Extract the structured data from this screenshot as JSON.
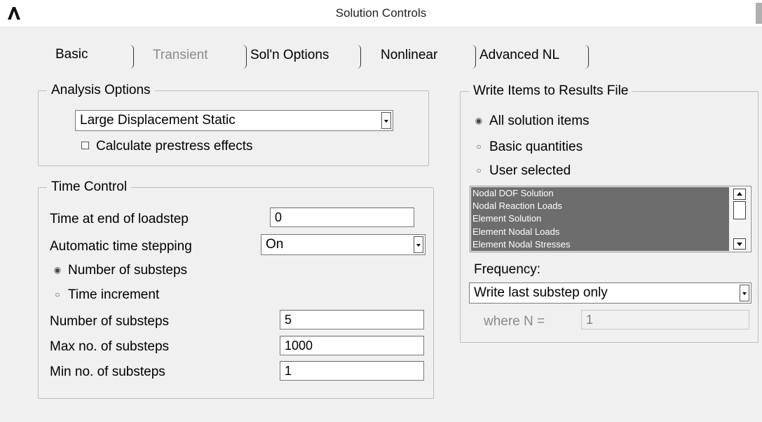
{
  "window": {
    "title": "Solution Controls",
    "icon": "ansys-logo-icon"
  },
  "tabs": [
    {
      "label": "Basic",
      "state": "active"
    },
    {
      "label": "Transient",
      "state": "disabled"
    },
    {
      "label": "Sol'n Options",
      "state": "normal"
    },
    {
      "label": "Nonlinear",
      "state": "normal"
    },
    {
      "label": "Advanced NL",
      "state": "normal"
    }
  ],
  "analysis_options": {
    "title": "Analysis Options",
    "analysis_type": "Large Displacement Static",
    "prestress_label": "Calculate prestress effects",
    "prestress_checked": false
  },
  "time_control": {
    "title": "Time Control",
    "time_end_label": "Time at end of loadstep",
    "time_end_value": "0",
    "auto_step_label": "Automatic time stepping",
    "auto_step_value": "On",
    "radio_substeps_label": "Number of substeps",
    "radio_increment_label": "Time increment",
    "radio_selected": "Number of substeps",
    "num_substeps_label": "Number of substeps",
    "num_substeps_value": "5",
    "max_substeps_label": "Max no. of substeps",
    "max_substeps_value": "1000",
    "min_substeps_label": "Min no. of substeps",
    "min_substeps_value": "1"
  },
  "write_items": {
    "title": "Write Items to Results File",
    "radio_all_label": "All solution items",
    "radio_basic_label": "Basic quantities",
    "radio_user_label": "User selected",
    "radio_selected": "All solution items",
    "list_items": [
      "Nodal DOF Solution",
      "Nodal Reaction Loads",
      "Element Solution",
      "Element Nodal Loads",
      "Element Nodal Stresses"
    ],
    "frequency_label": "Frequency:",
    "frequency_value": "Write last substep only",
    "where_n_label": "where N =",
    "where_n_value": "1"
  },
  "colors": {
    "background": "#f0f0f0",
    "disabled_text": "#8a8a8a",
    "list_selected_bg": "#6d6d6d"
  }
}
